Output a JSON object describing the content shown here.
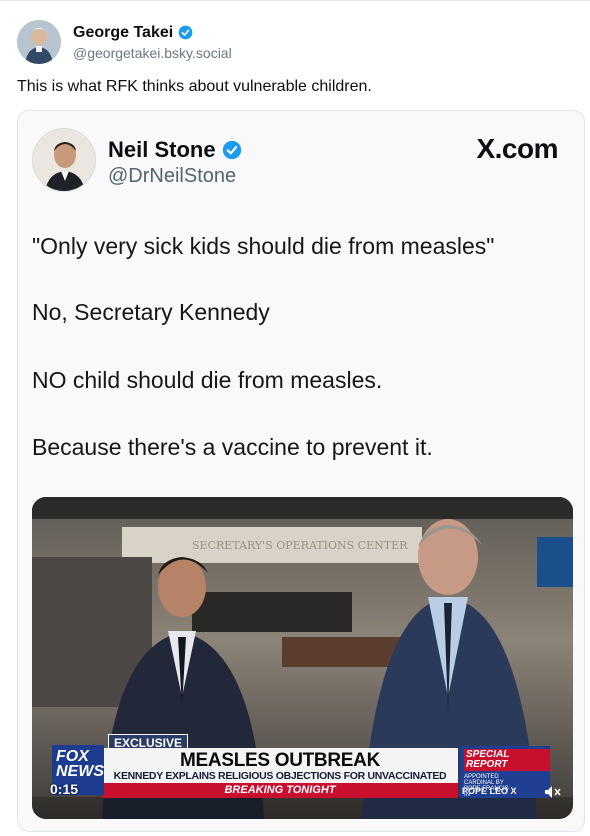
{
  "post": {
    "author_name": "George Takei",
    "author_handle": "@georgetakei.bsky.social",
    "text": "This is what RFK thinks about vulnerable children."
  },
  "embed": {
    "name": "Neil Stone",
    "handle": "@DrNeilStone",
    "brand": "X.com",
    "lines": [
      "\"Only very sick kids should die from measles\"",
      "No, Secretary Kennedy",
      "NO child should die from measles.",
      "Because there's a vaccine to prevent it."
    ]
  },
  "video": {
    "exclusive": "EXCLUSIVE",
    "headline": "MEASLES OUTBREAK",
    "subline": "KENNEDY EXPLAINS RELIGIOUS OBJECTIONS FOR UNVACCINATED",
    "breaking": "BREAKING TONIGHT",
    "network": "FOX NEWS",
    "timestamp": "0:15",
    "special_title": "SPECIAL REPORT",
    "special_sub": "APPOINTED CARDINAL BY POPE FRANCIS IN",
    "special_name": "POPE LEO X",
    "wall_text": "SECRETARY'S OPERATIONS CENTER",
    "speaker_icon": "speaker-muted-icon"
  },
  "colors": {
    "verified": "#1d9bf0",
    "fox_blue": "#1d3c8f",
    "breaking_red": "#c8102e"
  }
}
